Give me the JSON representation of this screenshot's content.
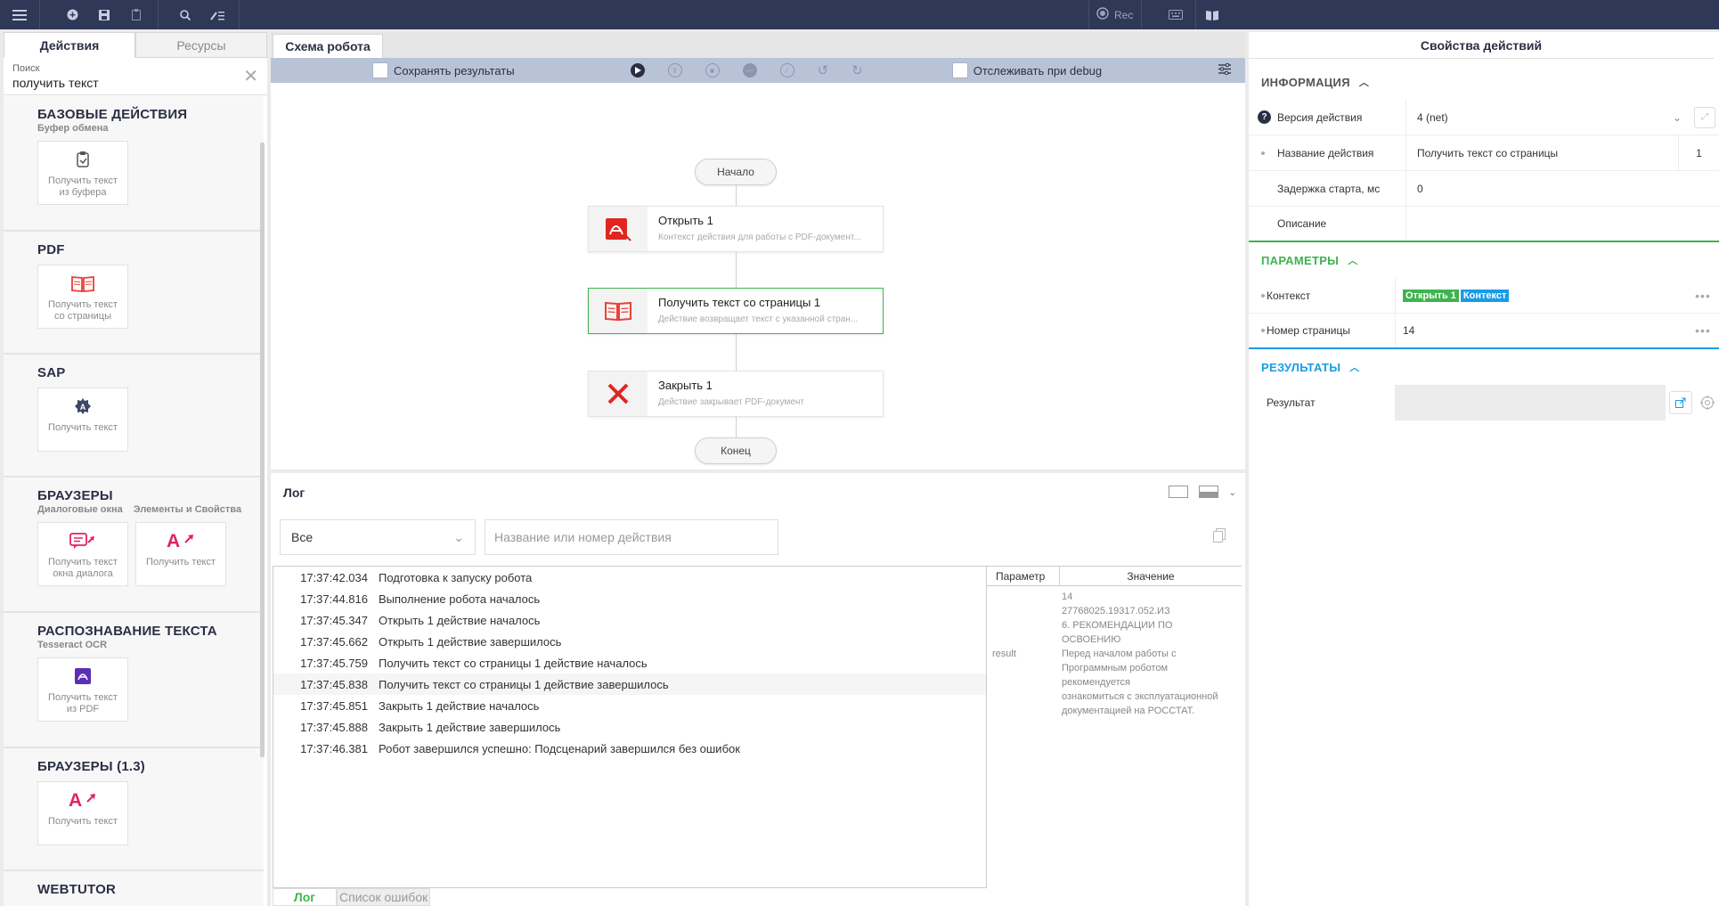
{
  "topbar": {
    "rec_label": "Rec",
    "icons": [
      "menu-icon",
      "add-icon",
      "save-icon",
      "clipboard-icon",
      "search-icon",
      "edit-list-icon",
      "record-icon",
      "keyboard-icon",
      "book-icon"
    ]
  },
  "left": {
    "tabs": [
      "Действия",
      "Ресурсы"
    ],
    "search_label": "Поиск",
    "search_value": "получить текст",
    "categories": [
      {
        "title": "БАЗОВЫЕ ДЕЙСТВИЯ",
        "subs": [
          "Буфер обмена"
        ],
        "cards": [
          "Получить текст\nиз буфера"
        ]
      },
      {
        "title": "PDF",
        "subs": [],
        "cards": [
          "Получить текст\nсо страницы"
        ]
      },
      {
        "title": "SAP",
        "subs": [],
        "cards": [
          "Получить текст"
        ]
      },
      {
        "title": "БРАУЗЕРЫ",
        "subs": [
          "Диалоговые окна",
          "Элементы и Свойства"
        ],
        "cards": [
          "Получить текст\nокна диалога",
          "Получить текст"
        ]
      },
      {
        "title": "РАСПОЗНАВАНИЕ ТЕКСТА",
        "subs": [
          "Tesseract OCR"
        ],
        "cards": [
          "Получить текст\nиз PDF"
        ]
      },
      {
        "title": "БРАУЗЕРЫ (1.3)",
        "subs": [],
        "cards": [
          "Получить текст"
        ]
      },
      {
        "title": "WEBTUTOR",
        "subs": [],
        "cards": []
      }
    ]
  },
  "center": {
    "tab": "Схема робота",
    "save_results": "Сохранять результаты",
    "track_debug": "Отслеживать при debug",
    "start": "Начало",
    "end": "Конец",
    "nodes": [
      {
        "title": "Открыть  1",
        "desc": "Контекст действия для работы с PDF-документ..."
      },
      {
        "title": "Получить текст со страницы  1",
        "desc": "Действие возвращает текст с указанной стран..."
      },
      {
        "title": "Закрыть  1",
        "desc": "Действие закрывает PDF-документ"
      }
    ]
  },
  "log": {
    "title": "Лог",
    "filter": "Все",
    "placeholder": "Название или номер действия",
    "rows": [
      {
        "time": "17:37:42.034",
        "text": "Подготовка к запуску робота"
      },
      {
        "time": "17:37:44.816",
        "text": "Выполнение робота началось"
      },
      {
        "time": "17:37:45.347",
        "text": "Открыть 1 действие началось"
      },
      {
        "time": "17:37:45.662",
        "text": "Открыть 1 действие завершилось"
      },
      {
        "time": "17:37:45.759",
        "text": "Получить текст со страницы 1 действие началось"
      },
      {
        "time": "17:37:45.838",
        "text": "Получить текст со страницы 1 действие завершилось"
      },
      {
        "time": "17:37:45.851",
        "text": "Закрыть 1 действие началось"
      },
      {
        "time": "17:37:45.888",
        "text": "Закрыть 1 действие завершилось"
      },
      {
        "time": "17:37:46.381",
        "text": "Робот завершился успешно: Подсценарий завершился без ошибок"
      }
    ],
    "param_head": "Параметр",
    "value_head": "Значение",
    "param_key": "result",
    "param_value": "14\n27768025.19317.052.ИЗ\n6. РЕКОМЕНДАЦИИ ПО\nОСВОЕНИЮ\nПеред началом работы с\nПрограммным роботом\nрекомендуется\nознакомиться с эксплуатационной\nдокументацией на РОССТАТ.",
    "tabs": [
      "Лог",
      "Список ошибок"
    ]
  },
  "right": {
    "title": "Свойства действий",
    "sec_info": "ИНФОРМАЦИЯ",
    "sec_params": "ПАРАМЕТРЫ",
    "sec_results": "РЕЗУЛЬТАТЫ",
    "version_label": "Версия действия",
    "version_value": "4 (net)",
    "name_label": "Название действия",
    "name_value": "Получить текст со страницы",
    "name_num": "1",
    "delay_label": "Задержка старта, мс",
    "delay_value": "0",
    "desc_label": "Описание",
    "desc_value": "",
    "context_label": "Контекст",
    "context_tag1": "Открыть 1",
    "context_tag2": "Контекст",
    "page_label": "Номер страницы",
    "page_value": "14",
    "result_label": "Результат",
    "colors": {
      "green": "#3fb34f",
      "blue": "#1a9be6",
      "info_gray": "#555555"
    }
  }
}
